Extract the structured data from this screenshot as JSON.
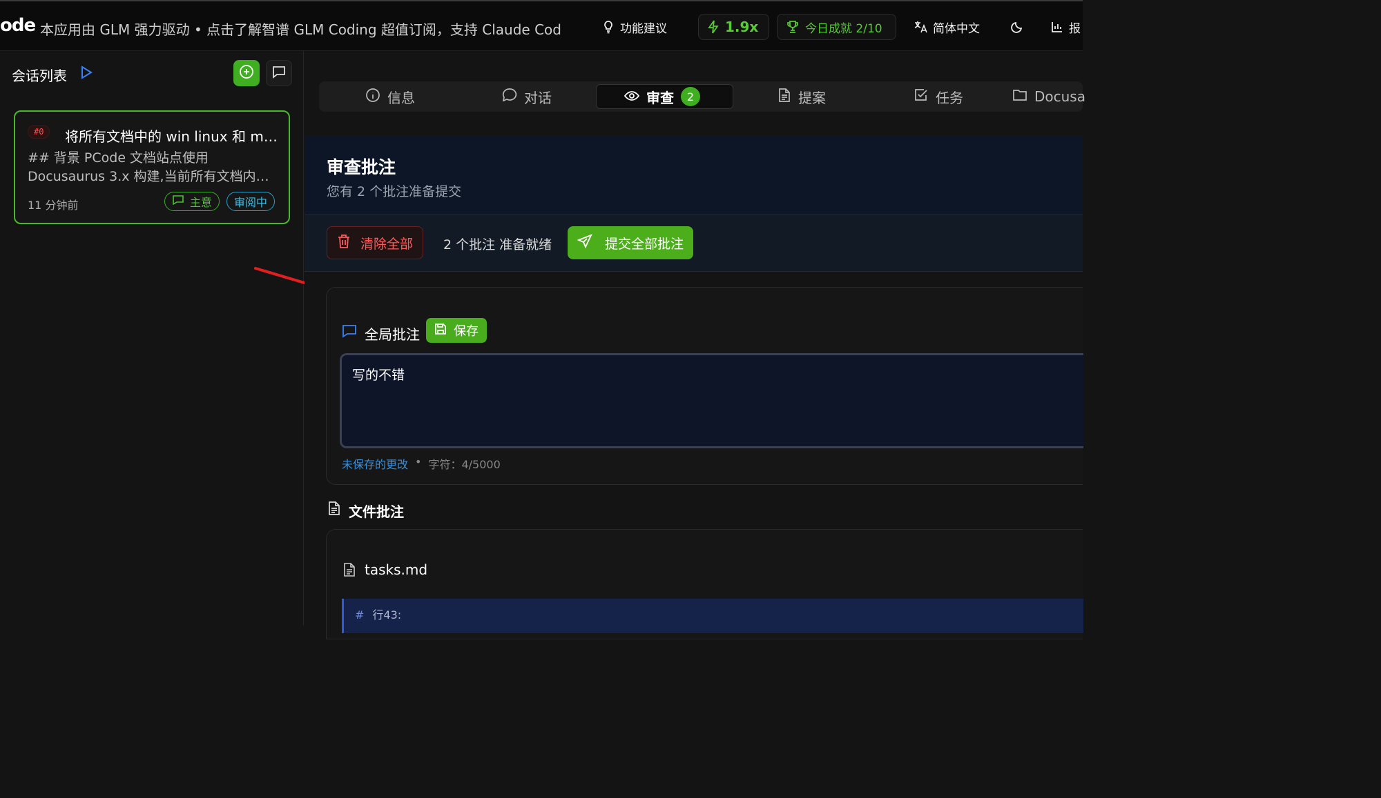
{
  "topbar": {
    "logo": "ode",
    "banner": "本应用由 GLM 强力驱动 • 点击了解智谱 GLM Coding 超值订阅，支持 Claude Code、C",
    "feature_suggest": "功能建议",
    "speed": "1.9x",
    "achievement": "今日成就 2/10",
    "language": "简体中文",
    "report_partial": "报"
  },
  "sidebar": {
    "title": "会话列表",
    "session": {
      "id": "#0",
      "title": "将所有文档中的 win linux 和 mac...",
      "desc_line1": "## 背景 PCode 文档站点使用",
      "desc_line2": "Docusaurus 3.x 构建,当前所有文档内容...",
      "time": "11 分钟前",
      "badge_theme": "主意",
      "badge_status": "审阅中"
    }
  },
  "tabs": [
    {
      "label": "信息",
      "icon": "info-icon"
    },
    {
      "label": "对话",
      "icon": "chat-icon"
    },
    {
      "label": "审查",
      "icon": "eye-icon",
      "count": "2"
    },
    {
      "label": "提案",
      "icon": "document-icon"
    },
    {
      "label": "任务",
      "icon": "checkbox-icon"
    },
    {
      "label": "Docusa",
      "icon": "folder-icon"
    }
  ],
  "review": {
    "title": "审查批注",
    "subtitle": "您有 2 个批注准备提交",
    "clear_all": "清除全部",
    "ready_text": "2 个批注 准备就绪",
    "submit_all": "提交全部批注",
    "global_label": "全局批注",
    "save": "保存",
    "global_text": "写的不错",
    "unsaved": "未保存的更改",
    "separator": "•",
    "chars": "字符：4/5000",
    "file_section_title": "文件批注",
    "file_name": "tasks.md",
    "file_line_hash": "#",
    "file_line": "行43:"
  },
  "colors": {
    "accent_green": "#4cae1b",
    "danger_red": "#ff5a5a",
    "link_blue": "#3a8fd9",
    "review_blue": "#3fc0ea",
    "arrow_red": "#e02020"
  }
}
